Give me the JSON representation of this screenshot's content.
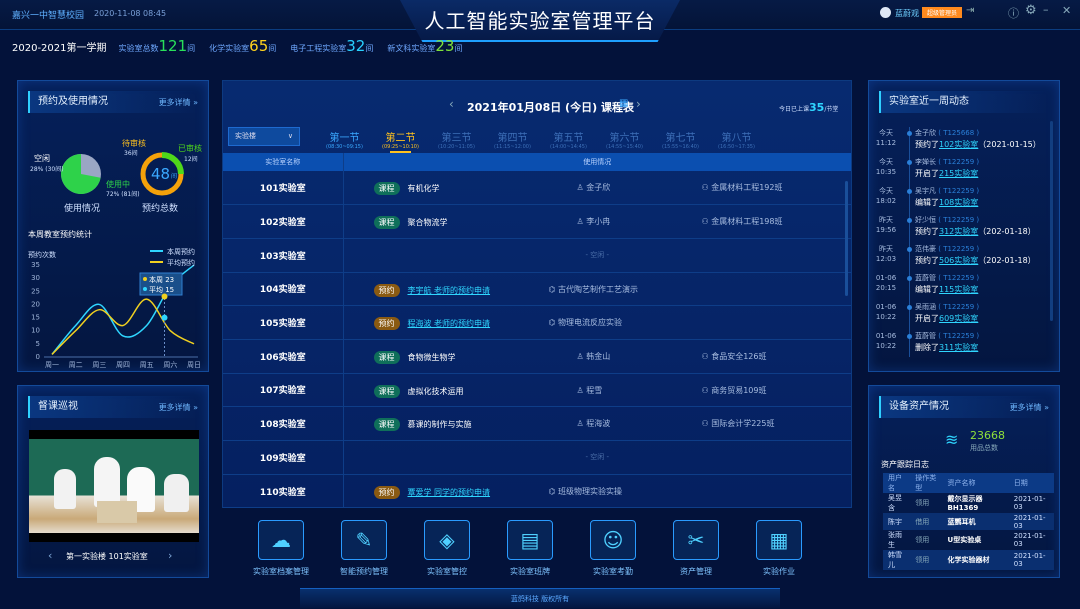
{
  "header": {
    "school": "嘉兴一中智慧校园",
    "datetime": "2020-11-08  08:45",
    "title": "人工智能实验室管理平台",
    "user": "蓝蔚观",
    "role": "超级管理员"
  },
  "summary": {
    "term": "2020-2021第一学期",
    "items": [
      {
        "label": "实验室总数",
        "value": "121",
        "unit": "间",
        "color": "#29e05a"
      },
      {
        "label": "化学实验室",
        "value": "65",
        "unit": "间",
        "color": "#ffd21e"
      },
      {
        "label": "电子工程实验室",
        "value": "32",
        "unit": "间",
        "color": "#29d0ff"
      },
      {
        "label": "新文科实验室",
        "value": "23",
        "unit": "间",
        "color": "#7ee03a"
      }
    ]
  },
  "booking": {
    "title": "预约及使用情况",
    "more": "更多详情 »",
    "idle_label": "空闲",
    "idle_value": "28% (30间)",
    "inuse_label": "使用中",
    "inuse_value": "72% (81间)",
    "pie_caption": "使用情况",
    "pending_label": "待审核",
    "pending_value": "36间",
    "approved_label": "已审核",
    "approved_value": "12间",
    "total": "48",
    "total_unit": "间",
    "ring_caption": "预约总数",
    "pie_fraction_inuse": 0.72,
    "ring_fraction_approved": 0.25
  },
  "chart_data": {
    "type": "line",
    "title": "本周教室预约统计",
    "ylabel": "预约次数",
    "categories": [
      "周一",
      "周二",
      "周三",
      "周四",
      "周五",
      "周六",
      "周日"
    ],
    "ylim": [
      0,
      35
    ],
    "yticks": [
      0,
      5,
      10,
      15,
      20,
      25,
      30,
      35
    ],
    "series": [
      {
        "name": "本周预约",
        "color": "#2fd6ff",
        "values": [
          1,
          12,
          20,
          8,
          12,
          27,
          35
        ]
      },
      {
        "name": "平均预约",
        "color": "#f0d020",
        "values": [
          1,
          10,
          18,
          12,
          22,
          10,
          5
        ]
      }
    ],
    "tooltip": {
      "lines": [
        "本周 23",
        "平均 15"
      ]
    },
    "legend": "top-right",
    "grid": false
  },
  "patrol": {
    "title": "督课巡视",
    "more": "更多详情 »",
    "location": "第一实验楼  101实验室"
  },
  "schedule": {
    "title": "2021年01月08日 (今日) 课程表",
    "today_label": "今日已上课",
    "today_count": "35",
    "today_unit": "/节堂",
    "building": "实验楼",
    "col_room": "实验室名称",
    "col_usage": "使用情况",
    "periods": [
      {
        "name": "第一节",
        "time": "(08:30~09:15)"
      },
      {
        "name": "第二节",
        "time": "(09:25~10:10)"
      },
      {
        "name": "第三节",
        "time": "(10:20~11:05)"
      },
      {
        "name": "第四节",
        "time": "(11:15~12:00)"
      },
      {
        "name": "第五节",
        "time": "(14:00~14:45)"
      },
      {
        "name": "第六节",
        "time": "(14:55~15:40)"
      },
      {
        "name": "第七节",
        "time": "(15:55~16:40)"
      },
      {
        "name": "第八节",
        "time": "(16:50~17:35)"
      }
    ],
    "rows": [
      {
        "room": "101实验室",
        "type": "课程",
        "subject": "有机化学",
        "teacher": "金子欣",
        "cls": "金属材料工程192班"
      },
      {
        "room": "102实验室",
        "type": "课程",
        "subject": "聚合物流学",
        "teacher": "李小冉",
        "cls": "金属材料工程198班"
      },
      {
        "room": "103实验室",
        "empty": "- 空闲 -"
      },
      {
        "room": "104实验室",
        "type": "预约",
        "subject": "李宇航 老师的预约申请",
        "topic": "古代陶艺制作工艺演示"
      },
      {
        "room": "105实验室",
        "type": "预约",
        "subject": "程海波 老师的预约申请",
        "topic": "物理电流反应实验"
      },
      {
        "room": "106实验室",
        "type": "课程",
        "subject": "食物微生物学",
        "teacher": "韩金山",
        "cls": "食品安全126班"
      },
      {
        "room": "107实验室",
        "type": "课程",
        "subject": "虚拟化技术运用",
        "teacher": "程雪",
        "cls": "商务贸易109班"
      },
      {
        "room": "108实验室",
        "type": "课程",
        "subject": "慕课的制作与实施",
        "teacher": "程海波",
        "cls": "国际会计学225班"
      },
      {
        "room": "109实验室",
        "empty": "- 空闲 -"
      },
      {
        "room": "110实验室",
        "type": "预约",
        "subject": "覃爱学 同学的预约申请",
        "topic": "班级物理实验实操"
      }
    ]
  },
  "activity": {
    "title": "实验室近一周动态",
    "items": [
      {
        "d": "今天",
        "t": "11:12",
        "n": "金子欣",
        "id": "( T125668 )",
        "act": "预约了",
        "room": "102实验室",
        "extra": "（2021-01-15）"
      },
      {
        "d": "今天",
        "t": "10:35",
        "n": "李婵长",
        "id": "( T122259 )",
        "act": "开启了",
        "room": "215实验室",
        "extra": ""
      },
      {
        "d": "今天",
        "t": "18:02",
        "n": "吴宇凡",
        "id": "( T122259 )",
        "act": "编辑了",
        "room": "108实验室",
        "extra": ""
      },
      {
        "d": "昨天",
        "t": "19:56",
        "n": "好少恒",
        "id": "( T122259 )",
        "act": "预约了",
        "room": "312实验室",
        "extra": "（202-01-18）"
      },
      {
        "d": "昨天",
        "t": "12:03",
        "n": "范伟豪",
        "id": "( T122259 )",
        "act": "预约了",
        "room": "506实验室",
        "extra": "（202-01-18）"
      },
      {
        "d": "01-06",
        "t": "20:15",
        "n": "蓝蔚管",
        "id": "( T122259 )",
        "act": "编辑了",
        "room": "115实验室",
        "extra": ""
      },
      {
        "d": "01-06",
        "t": "10:22",
        "n": "吴雨涵",
        "id": "( T122259 )",
        "act": "开启了",
        "room": "609实验室",
        "extra": ""
      },
      {
        "d": "01-06",
        "t": "10:22",
        "n": "蓝蔚管",
        "id": "( T122259 )",
        "act": "删除了",
        "room": "311实验室",
        "extra": ""
      }
    ]
  },
  "assets": {
    "title": "设备资产情况",
    "more": "更多详情 »",
    "total": "23668",
    "total_label": "用品总数",
    "log_title": "资产跟踪日志",
    "cols": [
      "用户名",
      "操作类型",
      "资产名称",
      "日期"
    ],
    "rows": [
      [
        "吴昱含",
        "领用",
        "戴尔显示器BH1369",
        "2021-01-03"
      ],
      [
        "陈宇",
        "借用",
        "蓝鹦耳机",
        "2021-01-03"
      ],
      [
        "张雨生",
        "领用",
        "U型实验桌",
        "2021-01-03"
      ],
      [
        "韩雪儿",
        "领用",
        "化学实验器材",
        "2021-01-03"
      ]
    ]
  },
  "modules": [
    {
      "label": "实验室档案管理",
      "icon": "☁"
    },
    {
      "label": "智能预约管理",
      "icon": "✎"
    },
    {
      "label": "实验室管控",
      "icon": "◈"
    },
    {
      "label": "实验室班牌",
      "icon": "▤"
    },
    {
      "label": "实验室考勤",
      "icon": "☺"
    },
    {
      "label": "资产管理",
      "icon": "✂"
    },
    {
      "label": "实验作业",
      "icon": "▦"
    }
  ],
  "footer": "蓝鸽科技  版权所有"
}
